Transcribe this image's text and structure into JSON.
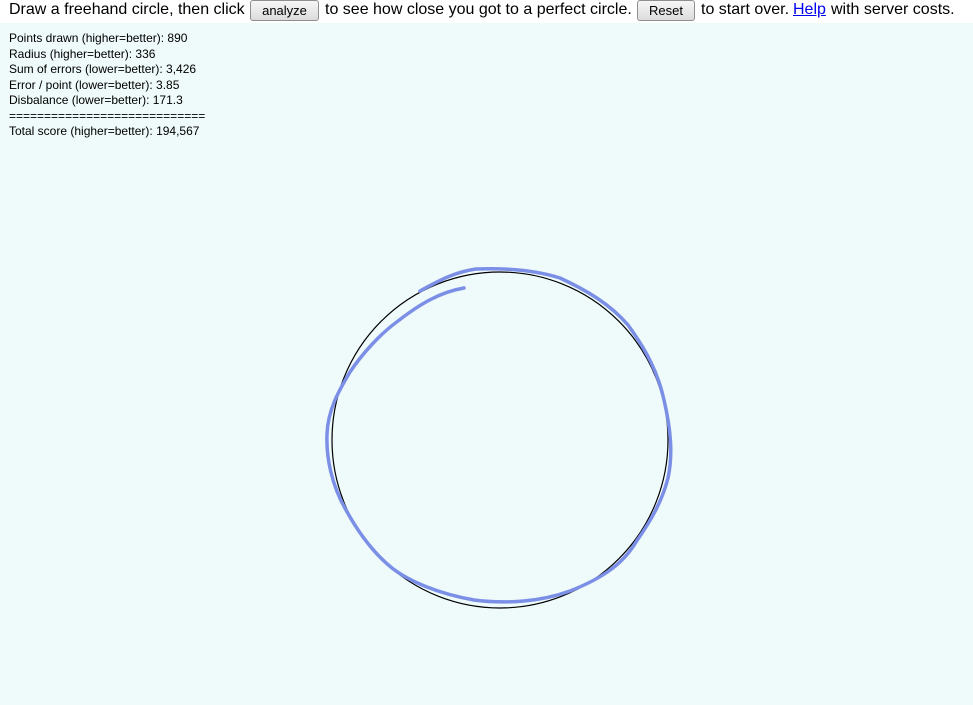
{
  "toolbar": {
    "text1": "Draw a freehand circle, then click",
    "analyze_label": "analyze",
    "text2": "to see how close you got to a perfect circle.",
    "reset_label": "Reset",
    "text3": "to start over.",
    "help_label": "Help",
    "text4": "with server costs."
  },
  "stats": {
    "points": "Points drawn (higher=better): 890",
    "radius": "Radius (higher=better): 336",
    "sum_errors": "Sum of errors (lower=better): 3,426",
    "error_point": "Error / point (lower=better): 3.85",
    "disbalance": "Disbalance (lower=better): 171.3",
    "separator": "============================",
    "total": "Total score (higher=better): 194,567"
  },
  "colors": {
    "canvas_bg": "#effafa",
    "freehand_stroke": "#7b8fe6",
    "perfect_circle_stroke": "#000000",
    "link": "#0000ee"
  }
}
